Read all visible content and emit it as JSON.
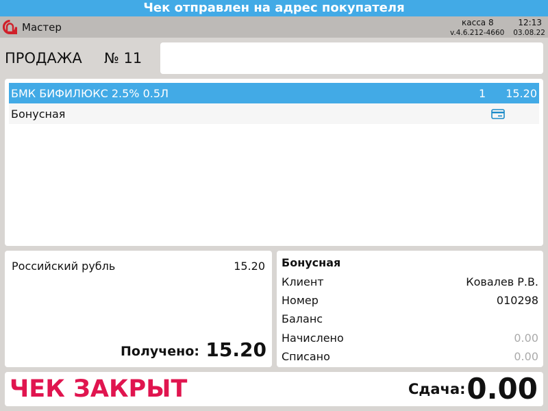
{
  "banner": {
    "message": "Чек отправлен на адрес покупателя"
  },
  "status_bar": {
    "user": "Мастер",
    "register": "касса 8",
    "time": "12:13",
    "version": "v.4.6.212-4660",
    "date": "03.08.22"
  },
  "sale": {
    "title": "ПРОДАЖА",
    "number": "№ 11"
  },
  "items": [
    {
      "name": "БМК БИФИЛЮКС 2.5% 0.5Л",
      "quantity": "1",
      "price": "15.20"
    }
  ],
  "bonus_line": {
    "label": "Бонусная",
    "icon": "card-icon"
  },
  "payment": {
    "currency": "Российский рубль",
    "amount": "15.20",
    "received_label": "Получено:",
    "received_value": "15.20"
  },
  "bonus_card": {
    "title": "Бонусная",
    "rows": [
      {
        "label": "Клиент",
        "value": "Ковалев Р.В."
      },
      {
        "label": "Номер",
        "value": "010298"
      },
      {
        "label": "Баланс",
        "value": ""
      },
      {
        "label": "Начислено",
        "value": "0.00"
      },
      {
        "label": "Списано",
        "value": "0.00"
      }
    ]
  },
  "footer": {
    "status": "ЧЕК ЗАКРЫТ",
    "change_label": "Сдача:",
    "change_value": "0.00"
  },
  "colors": {
    "accent": "#42aae6",
    "closed": "#e0154f",
    "logo": "#d0202a",
    "card_icon": "#1a8ac8"
  }
}
